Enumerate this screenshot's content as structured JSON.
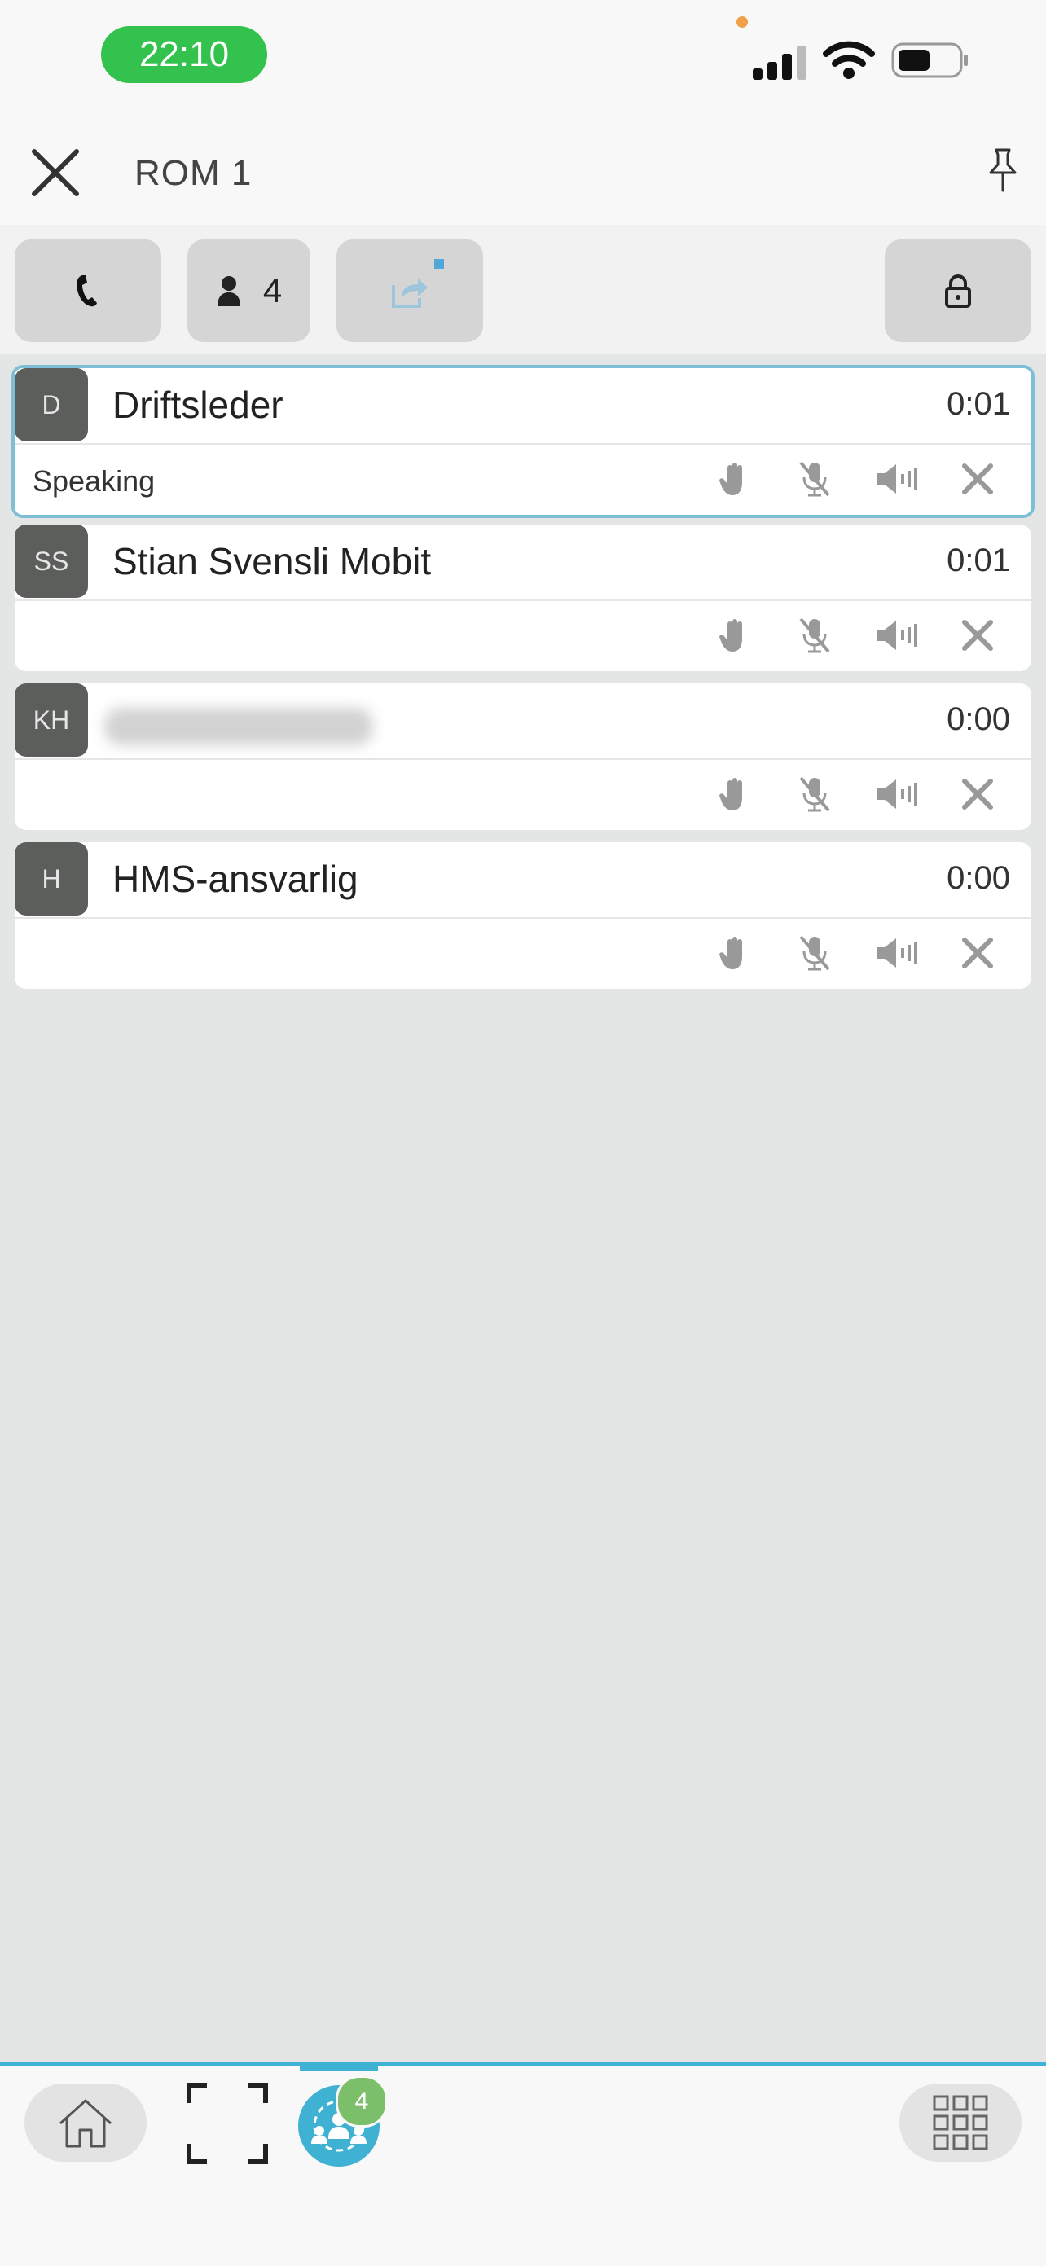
{
  "status_bar": {
    "time": "22:10"
  },
  "header": {
    "title": "ROM 1"
  },
  "toolbar": {
    "participant_count": "4"
  },
  "participants": [
    {
      "initials": "D",
      "name": "Driftsleder",
      "duration": "0:01",
      "status": "Speaking",
      "active": true
    },
    {
      "initials": "SS",
      "name": "Stian Svensli Mobit",
      "duration": "0:01",
      "status": "",
      "active": false
    },
    {
      "initials": "KH",
      "name": "",
      "duration": "0:00",
      "status": "",
      "active": false
    },
    {
      "initials": "H",
      "name": "HMS-ansvarlig",
      "duration": "0:00",
      "status": "",
      "active": false
    }
  ],
  "bottom_nav": {
    "group_badge": "4"
  },
  "colors": {
    "accent": "#3fb1d3",
    "time_pill": "#34c24e",
    "badge": "#7bbf6a",
    "avatar": "#5b5e5b"
  }
}
